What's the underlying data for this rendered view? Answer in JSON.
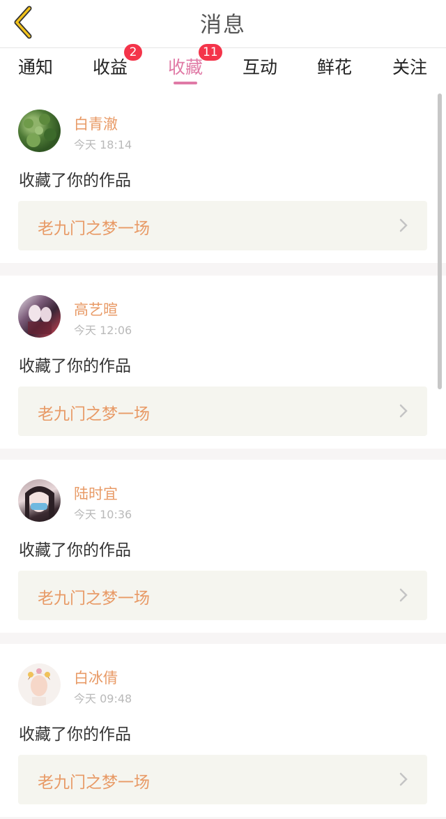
{
  "header": {
    "title": "消息",
    "back_icon": "chevron-left-icon"
  },
  "tabs": [
    {
      "label": "通知",
      "badge": ""
    },
    {
      "label": "收益",
      "badge": "2"
    },
    {
      "label": "收藏",
      "badge": "11",
      "active": true
    },
    {
      "label": "互动",
      "badge": ""
    },
    {
      "label": "鲜花",
      "badge": ""
    },
    {
      "label": "关注",
      "badge": ""
    }
  ],
  "messages": [
    {
      "name": "白青澈",
      "time": "今天 18:14",
      "action": "收藏了你的作品",
      "work": "老九门之梦一场"
    },
    {
      "name": "高艺暄",
      "time": "今天 12:06",
      "action": "收藏了你的作品",
      "work": "老九门之梦一场"
    },
    {
      "name": "陆时宜",
      "time": "今天 10:36",
      "action": "收藏了你的作品",
      "work": "老九门之梦一场"
    },
    {
      "name": "白冰倩",
      "time": "今天 09:48",
      "action": "收藏了你的作品",
      "work": "老九门之梦一场"
    }
  ],
  "colors": {
    "accent_pink": "#e07aa6",
    "name_orange": "#e89a66",
    "badge_red": "#f4344a",
    "back_yellow": "#f2c21b"
  }
}
